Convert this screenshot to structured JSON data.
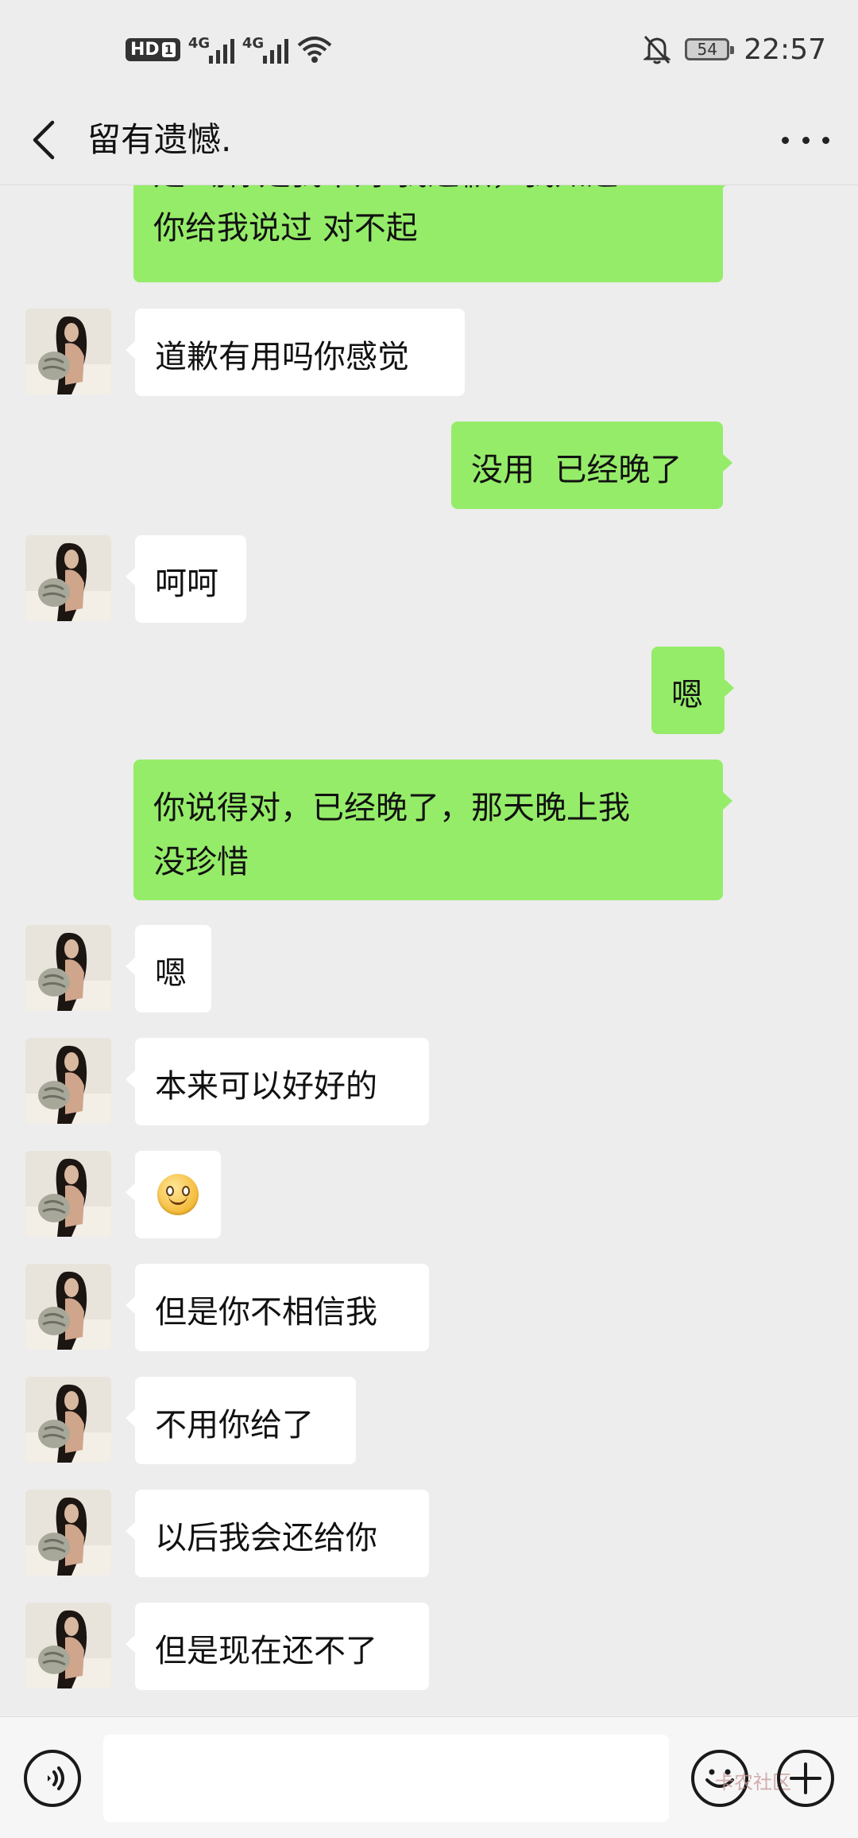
{
  "status_bar": {
    "hd_label": "HD",
    "hd_sub": "1",
    "network1": "4G",
    "network2": "4G",
    "battery": "54",
    "time": "22:57"
  },
  "header": {
    "title": "留有遗憾."
  },
  "messages": [
    {
      "from": "me",
      "text": "是 踢你是我不对 我道歉，我知道\n你给我说过 对不起"
    },
    {
      "from": "other",
      "text": "道歉有用吗你感觉"
    },
    {
      "from": "me",
      "text": "没用  已经晚了"
    },
    {
      "from": "other",
      "text": "呵呵"
    },
    {
      "from": "me",
      "text": "嗯"
    },
    {
      "from": "me",
      "text": "你说得对，已经晚了，那天晚上我\n没珍惜"
    },
    {
      "from": "other",
      "text": "嗯"
    },
    {
      "from": "other",
      "text": "本来可以好好的"
    },
    {
      "from": "other",
      "text": "",
      "emoji": "smile-emoji"
    },
    {
      "from": "other",
      "text": "但是你不相信我"
    },
    {
      "from": "other",
      "text": "不用你给了"
    },
    {
      "from": "other",
      "text": "以后我会还给你"
    },
    {
      "from": "other",
      "text": "但是现在还不了"
    }
  ],
  "input": {
    "value": "",
    "placeholder": ""
  },
  "watermark": "卡农社区",
  "colors": {
    "background": "#ededed",
    "outgoing_bubble": "#95ec69",
    "incoming_bubble": "#ffffff"
  },
  "icons": {
    "back": "back-arrow-icon",
    "more": "more-dots-icon",
    "voice": "voice-icon",
    "emoji": "emoji-icon",
    "plus": "plus-icon"
  }
}
